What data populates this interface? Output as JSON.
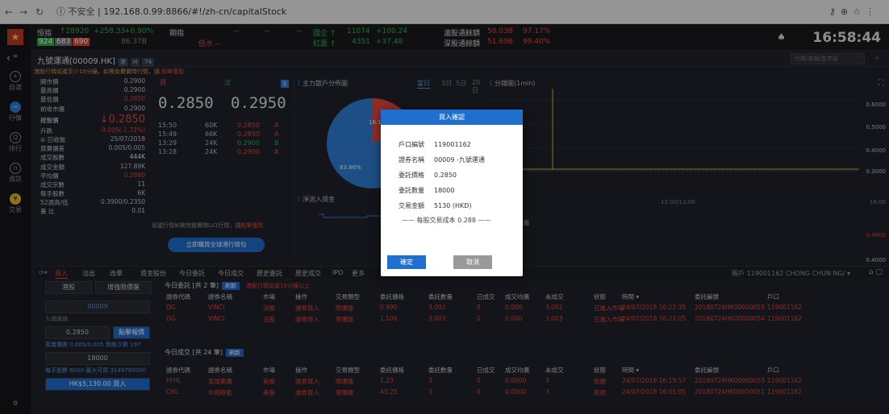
{
  "browser": {
    "security": "不安全",
    "url": "192.168.0.99:8866/#!/zh-cn/capitalStock"
  },
  "leftnav": {
    "items": [
      "自選",
      "行情",
      "排行",
      "資訊",
      "交易"
    ]
  },
  "ticker": {
    "hsi_label": "恒指",
    "hsi_value": "↑28920",
    "hsi_change": "+258.33",
    "hsi_pct": "+0.90%",
    "counts": [
      "924",
      "683",
      "690"
    ],
    "turnover": "86.37B",
    "futures_label": "期指",
    "futures_sub": "低水 --",
    "dash1": "--",
    "dash2": "--",
    "dash3": "--",
    "gq_label": "國企 ↑",
    "gq_value": "11074",
    "gq_change": "+100.24",
    "hc_label": "紅籌 ↑",
    "hc_value": "4351",
    "hc_change": "+37.48",
    "hk_sh_label": "滬股通餘額",
    "hk_sh_value": "50.03B",
    "hk_sh_pct": "97.17%",
    "hk_sz_label": "深股通餘額",
    "hk_sz_value": "51.69B",
    "hk_sz_pct": "99.40%",
    "clock": "16:58:44"
  },
  "stockbar": {
    "name": "九號運通[00009.HK]",
    "badges": [
      "港",
      "H",
      "74"
    ],
    "search_placeholder": "代碼/名稱/首字母"
  },
  "notice": {
    "text": "港股行情延遲至少15分鐘。如需免費實時行情，請",
    "link": "點擊獲取"
  },
  "quote": {
    "rows": [
      {
        "label": "開市價",
        "value": "0.2900"
      },
      {
        "label": "最高價",
        "value": "0.2900"
      },
      {
        "label": "最低價",
        "value": "0.2850"
      },
      {
        "label": "前收市價",
        "value": "0.2900"
      },
      {
        "label": "按盤價",
        "value": "↓0.2850"
      },
      {
        "label": "升跌",
        "value": "-0.005(-1.72%)"
      },
      {
        "label": "⊘ 已收盤",
        "value": "25/07/2018"
      },
      {
        "label": "買賣價差",
        "value": "0.005/0.005"
      },
      {
        "label": "成交股數",
        "value": "444K"
      },
      {
        "label": "成交金額",
        "value": "127.89K"
      },
      {
        "label": "平均價",
        "value": "0.2880"
      },
      {
        "label": "成交宗數",
        "value": "11"
      },
      {
        "label": "每手股數",
        "value": "6K"
      },
      {
        "label": "52週高/低",
        "value": "0.3900/0.2350"
      },
      {
        "label": "量 比",
        "value": "0.01"
      }
    ]
  },
  "bidask": {
    "buy_label": "買",
    "sell_label": "沽",
    "bid": "0.2850",
    "ask": "0.2950",
    "badge": "1",
    "trades": [
      {
        "time": "15:50",
        "vol": "60K",
        "price": "0.2850",
        "side": "A"
      },
      {
        "time": "15:49",
        "vol": "66K",
        "price": "0.2850",
        "side": "A"
      },
      {
        "time": "13:29",
        "vol": "24K",
        "price": "0.2900",
        "side": "B"
      },
      {
        "time": "13:28",
        "vol": "24K",
        "price": "0.2900",
        "side": "A"
      }
    ],
    "lv2_text": "延遲行情如需完整實時LV2行情，請",
    "lv2_link": "點擊獲取",
    "global_btn": "立即購買全球港行情包"
  },
  "chartL": {
    "title": "主力散戶分佈圖",
    "tf": [
      "當日",
      "3日",
      "5日",
      "20日"
    ],
    "pie_pct_a": "16.14%",
    "pie_pct_b": "83.86%",
    "flow_title": "淨流入資金"
  },
  "chartR": {
    "title": "分鐘圖(1min)",
    "y": [
      "0.6000",
      "0.5000",
      "0.4000",
      "0.3000",
      "0.4800",
      "0.4000"
    ],
    "x_mid": "12:00/13:00",
    "x_end": "16:00",
    "label_zhe": "圖"
  },
  "modal": {
    "title": "買入確認",
    "rows": [
      {
        "k": "戶口編號",
        "v": "119001162"
      },
      {
        "k": "證券名稱",
        "v": "00009 -九號運通"
      },
      {
        "k": "委託價格",
        "v": "0.2850"
      },
      {
        "k": "委託數量",
        "v": "18000"
      },
      {
        "k": "交易金額",
        "v": "5130 (HKD)"
      }
    ],
    "note": "—— 每股交易成本 0.288 ——",
    "ok": "確定",
    "cancel": "取消"
  },
  "tabs": {
    "items": [
      "買入",
      "沽出",
      "改單",
      "資金股份",
      "今日委託",
      "今日成交",
      "歷史委託",
      "歷史成交",
      "IPO",
      "更多"
    ],
    "account": "賬戶 119001162 CHONG CHUN NG/ ▾"
  },
  "orderpanel": {
    "market": "港股",
    "order_type": "增強限價盤",
    "code": "00009",
    "name": "九號運通",
    "price": "0.2850",
    "price_btn": "點擊報價",
    "spread_label": "買賣價差 0.005/0.005  倒差次數 197",
    "qty": "18000",
    "qty_note": "每手股數 6000 最大可買 3149760000",
    "buy_btn": "HK$5,130.00 買入"
  },
  "table1": {
    "title": "今日委託 [共 2 筆]",
    "refresh": "刷新",
    "warn": "港股行情延遲15分鐘以上",
    "headers": [
      "證券代碼",
      "證券名稱",
      "市場",
      "操作",
      "交易類型",
      "委託價格",
      "委託數量",
      "已成交",
      "成交均價",
      "未成交",
      "狀態",
      "時間 ▾",
      "委託編號",
      "戶口"
    ],
    "rows": [
      [
        "DG",
        "VINCI",
        "法股",
        "證券買入",
        "限價盤",
        "0.990",
        "3,002",
        "0",
        "0.000",
        "3,002",
        "已進入市場",
        "24/07/2018 16:22:35",
        "20180724HK00000055",
        "119001162"
      ],
      [
        "DG",
        "VINCI",
        "法股",
        "證券買入",
        "限價盤",
        "1.100",
        "3,003",
        "0",
        "0.000",
        "3,003",
        "已進入市場",
        "24/07/2018 16:22:05",
        "20180724HK00000054",
        "119001162"
      ]
    ]
  },
  "table2": {
    "title": "今日成交 [共 24 筆]",
    "refresh": "刷新",
    "headers": [
      "證券代碼",
      "證券名稱",
      "市場",
      "操作",
      "交易類型",
      "委託價格",
      "委託數量",
      "已成交",
      "成交均價",
      "未成交",
      "狀態",
      "時間 ▾",
      "委託編號",
      "戶口"
    ],
    "rows": [
      [
        "FFHL",
        "富維集團",
        "美股",
        "證券買入",
        "限價盤",
        "1.23",
        "3",
        "0",
        "0.0000",
        "3",
        "拒絕",
        "24/07/2018 16:19:57",
        "20180724HK00000053",
        "119001162"
      ],
      [
        "CHL",
        "中國移動",
        "美股",
        "證券買入",
        "限價盤",
        "43.25",
        "3",
        "0",
        "0.0000",
        "3",
        "拒絕",
        "24/07/2018 16:05:05",
        "20180724HK00000051",
        "119001162"
      ]
    ]
  }
}
